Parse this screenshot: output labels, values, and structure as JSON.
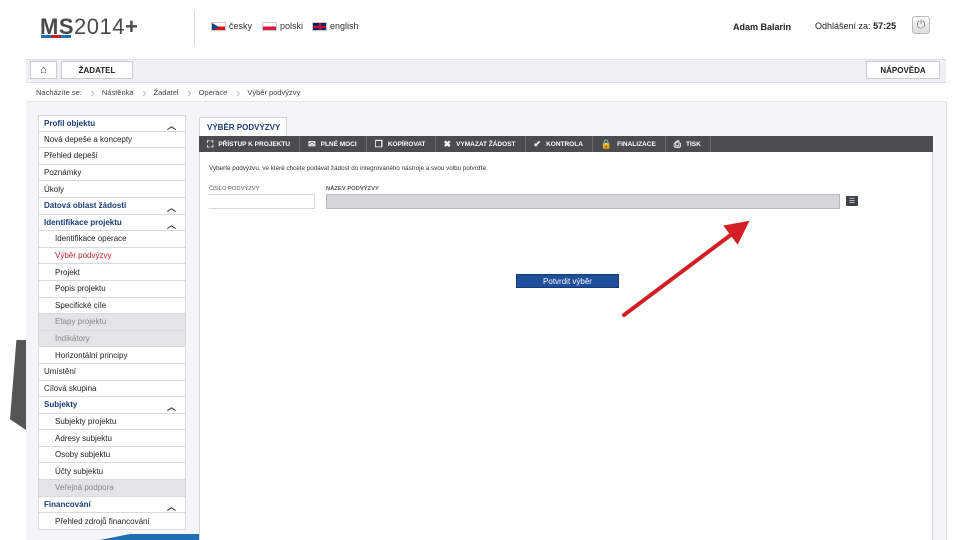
{
  "header": {
    "logo_ms": "MS",
    "logo_year": "2014",
    "logo_plus": "+",
    "logo_colors": [
      "#1f6fb4",
      "#c0202c",
      "#1f6fb4"
    ],
    "languages": [
      {
        "label": "česky",
        "flag": "cz"
      },
      {
        "label": "polski",
        "flag": "pl"
      },
      {
        "label": "english",
        "flag": "gb"
      }
    ],
    "user_name": "Adam Balarin",
    "logout_label": "Odhlášení za:",
    "logout_time": "57:25",
    "power_icon": "power-icon"
  },
  "toolbar": {
    "home_icon": "home-icon",
    "applicant_label": "ŽADATEL",
    "help_label": "NÁPOVĚDA"
  },
  "breadcrumb": [
    "Nacházíte se:",
    "Nástěnka",
    "Žadatel",
    "Operace",
    "Výběr podvýzvy"
  ],
  "sidebar": {
    "items": [
      {
        "label": "Profil objektu",
        "type": "head",
        "chevron": true
      },
      {
        "label": "Nová depeše a koncepty",
        "type": "item"
      },
      {
        "label": "Přehled depeší",
        "type": "item"
      },
      {
        "label": "Poznámky",
        "type": "item"
      },
      {
        "label": "Úkoly",
        "type": "item"
      },
      {
        "label": "Datová oblast žádosti",
        "type": "head",
        "chevron": true
      },
      {
        "label": "Identifikace projektu",
        "type": "head",
        "chevron": true
      },
      {
        "label": "Identifikace operace",
        "type": "sub"
      },
      {
        "label": "Výběr podvýzvy",
        "type": "sub",
        "active": true
      },
      {
        "label": "Projekt",
        "type": "sub"
      },
      {
        "label": "Popis projektu",
        "type": "sub"
      },
      {
        "label": "Specifické cíle",
        "type": "sub"
      },
      {
        "label": "Etapy projektu",
        "type": "sub",
        "disabled": true
      },
      {
        "label": "Indikátory",
        "type": "sub",
        "disabled": true
      },
      {
        "label": "Horizontální principy",
        "type": "sub"
      },
      {
        "label": "Umístění",
        "type": "item"
      },
      {
        "label": "Cílová skupina",
        "type": "item"
      },
      {
        "label": "Subjekty",
        "type": "head",
        "chevron": true
      },
      {
        "label": "Subjekty projektu",
        "type": "sub"
      },
      {
        "label": "Adresy subjektu",
        "type": "sub"
      },
      {
        "label": "Osoby subjektu",
        "type": "sub"
      },
      {
        "label": "Účty subjektu",
        "type": "sub"
      },
      {
        "label": "Veřejná podpora",
        "type": "sub",
        "disabled": true
      },
      {
        "label": "Financování",
        "type": "head",
        "chevron": true
      },
      {
        "label": "Přehled zdrojů financování",
        "type": "sub"
      }
    ]
  },
  "main": {
    "tab_label": "VÝBĚR PODVÝZVY",
    "actions": [
      {
        "label": "PŘÍSTUP K PROJEKTU",
        "icon": "sitemap-icon",
        "glyph": "⛶"
      },
      {
        "label": "PLNÉ MOCI",
        "icon": "envelope-icon",
        "glyph": "✉"
      },
      {
        "label": "KOPÍROVAT",
        "icon": "copy-icon",
        "glyph": "❐"
      },
      {
        "label": "VYMAZAT ŽÁDOST",
        "icon": "delete-icon",
        "glyph": "✖"
      },
      {
        "label": "KONTROLA",
        "icon": "check-icon",
        "glyph": "✔"
      },
      {
        "label": "FINALIZACE",
        "icon": "lock-icon",
        "glyph": "🔒"
      },
      {
        "label": "TISK",
        "icon": "print-icon",
        "glyph": "⎙"
      }
    ],
    "instruction": "Vyberte podvýzvu, ve které chcete podávat žádost do integrovaného nástroje a svou volbu potvrďte.",
    "field1_label": "ČÍSLO PODVÝZVY",
    "field1_value": "",
    "field2_label": "NÁZEV PODVÝZVY",
    "field2_value": "",
    "confirm_label": "Potvrdit výběr"
  },
  "colors": {
    "accent_blue": "#1f4e9b",
    "active_red": "#c0202c",
    "action_bar": "#4a4c50",
    "arrow_red": "#d21f26"
  }
}
